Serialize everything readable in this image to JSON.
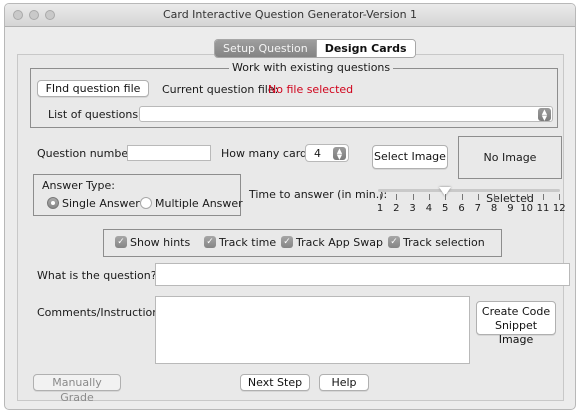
{
  "window": {
    "title": "Card Interactive Question Generator-Version 1"
  },
  "tabs": [
    {
      "label": "Setup Question",
      "active": true
    },
    {
      "label": "Design Cards",
      "active": false
    }
  ],
  "existing": {
    "legend": "Work with existing questions",
    "find_button": "FInd question file",
    "current_file_label": "Current question file:",
    "current_file_value": "No file selected",
    "list_label": "List of questions:",
    "list_value": ""
  },
  "question_number": {
    "label": "Question number:",
    "value": ""
  },
  "cards": {
    "label": "How many cards:",
    "value": "4"
  },
  "image": {
    "select_button": "Select Image",
    "status": "No Image Selected"
  },
  "answer_type": {
    "legend": "Answer Type:",
    "options": [
      {
        "label": "Single Answer",
        "selected": true
      },
      {
        "label": "Multiple Answer",
        "selected": false
      }
    ]
  },
  "time": {
    "label": "Time to answer (in min.):",
    "ticks": [
      "1",
      "2",
      "3",
      "4",
      "5",
      "6",
      "7",
      "8",
      "9",
      "10",
      "11",
      "12"
    ],
    "value": 5
  },
  "options": [
    {
      "label": "Show hints",
      "checked": true
    },
    {
      "label": "Track time",
      "checked": true
    },
    {
      "label": "Track App Swap",
      "checked": true
    },
    {
      "label": "Track selection",
      "checked": true
    }
  ],
  "question": {
    "label": "What is the question?",
    "value": ""
  },
  "comments": {
    "label": "Comments/Instructions:",
    "value": ""
  },
  "buttons": {
    "snippet": [
      "Create Code",
      "Snippet Image"
    ],
    "manual": "Manually Grade",
    "next": "Next Step",
    "help": "Help"
  }
}
